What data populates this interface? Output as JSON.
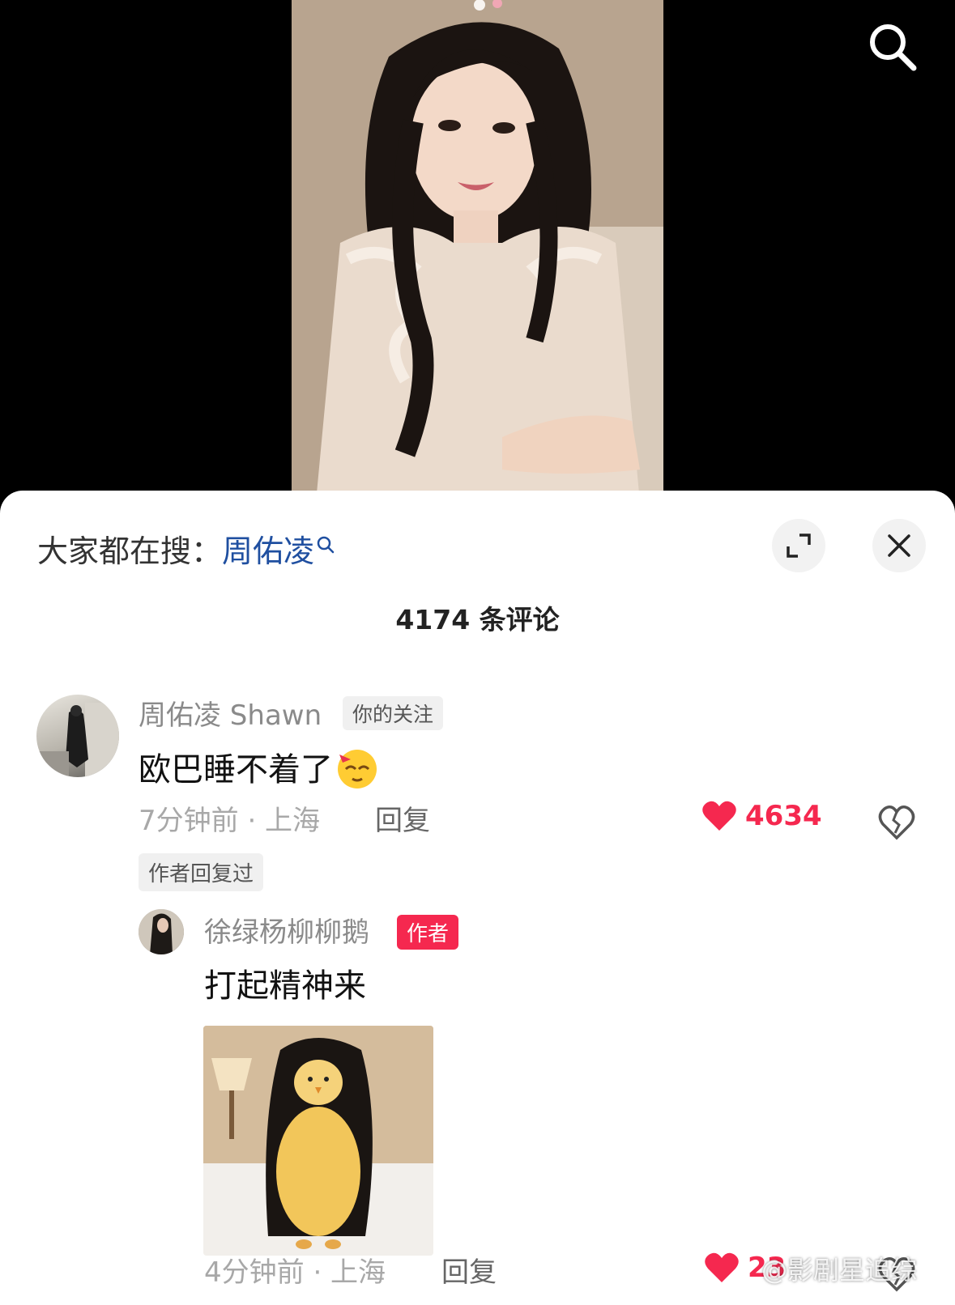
{
  "header": {
    "search_icon": "search-icon"
  },
  "panel": {
    "hot_search_prefix": "大家都在搜：",
    "hot_search_keyword": "周佑凌",
    "expand_icon": "expand-icon",
    "close_icon": "close-icon",
    "comment_count": "4174 条评论"
  },
  "comments": [
    {
      "username": "周佑凌 Shawn",
      "follow_tag": "你的关注",
      "text": "欧巴睡不着了",
      "emoji": "sleepy-face-emoji",
      "time_location": "7分钟前 · 上海",
      "reply_label": "回复",
      "likes": "4634",
      "author_replied_tag": "作者回复过"
    },
    {
      "username": "徐绿杨柳柳鹅",
      "author_tag": "作者",
      "text": "打起精神来",
      "sticker": "long-haired-chick-sticker",
      "time_location": "4分钟前 · 上海",
      "reply_label": "回复",
      "likes": "23"
    }
  ],
  "watermark": "@影剧星追综",
  "colors": {
    "accent_red": "#f5284f",
    "keyword_blue": "#1f4fa0",
    "background_top": "#000000",
    "panel_bg": "#ffffff"
  }
}
